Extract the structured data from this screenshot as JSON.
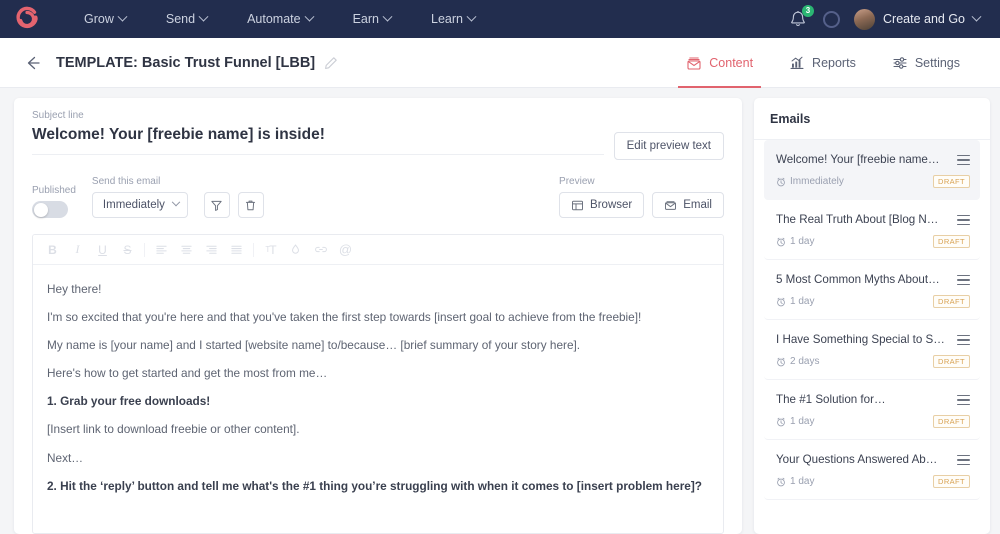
{
  "topnav": {
    "logo_icon": "spiral-logo-icon",
    "items": [
      {
        "label": "Grow"
      },
      {
        "label": "Send"
      },
      {
        "label": "Automate"
      },
      {
        "label": "Earn"
      },
      {
        "label": "Learn"
      }
    ],
    "notification_count": "3",
    "user_name": "Create and Go"
  },
  "subheader": {
    "title": "TEMPLATE: Basic Trust Funnel [LBB]",
    "tabs": [
      {
        "label": "Content",
        "icon": "envelope-icon",
        "active": true
      },
      {
        "label": "Reports",
        "icon": "bar-chart-icon",
        "active": false
      },
      {
        "label": "Settings",
        "icon": "sliders-icon",
        "active": false
      }
    ]
  },
  "editor_panel": {
    "subject_label": "Subject line",
    "subject_value": "Welcome! Your [freebie name] is inside!",
    "edit_preview_label": "Edit preview text",
    "published_label": "Published",
    "published_on": false,
    "send_label": "Send this email",
    "send_value": "Immediately",
    "preview_label": "Preview",
    "preview_browser_label": "Browser",
    "preview_email_label": "Email",
    "toolbar": [
      {
        "name": "bold-icon",
        "glyph": "B"
      },
      {
        "name": "italic-icon",
        "glyph": "I"
      },
      {
        "name": "underline-icon",
        "glyph": "U"
      },
      {
        "name": "strikethrough-icon",
        "glyph": "S"
      },
      {
        "name": "align-left-icon",
        "glyph": ""
      },
      {
        "name": "align-center-icon",
        "glyph": ""
      },
      {
        "name": "align-right-icon",
        "glyph": ""
      },
      {
        "name": "align-justify-icon",
        "glyph": ""
      },
      {
        "name": "font-size-icon",
        "glyph": "TT"
      },
      {
        "name": "text-color-icon",
        "glyph": ""
      },
      {
        "name": "link-icon",
        "glyph": ""
      },
      {
        "name": "mention-icon",
        "glyph": "@"
      }
    ],
    "body_paragraphs": [
      {
        "text": "Hey there!",
        "bold": false
      },
      {
        "text": " I'm so excited that you're here and that you've taken the first step towards [insert goal to achieve from the freebie]!",
        "bold": false
      },
      {
        "text": "My name is [your name] and I started [website name] to/because… [brief summary of your story here].",
        "bold": false
      },
      {
        "text": "Here's how to get started and get the most from me…",
        "bold": false
      },
      {
        "text": "1. Grab your free downloads!",
        "bold": true
      },
      {
        "text": "[Insert link to download freebie or other content].",
        "bold": false
      },
      {
        "text": "Next…",
        "bold": false
      },
      {
        "text": "2. Hit the ‘reply’ button and tell me what's the #1 thing you’re struggling with when it comes to [insert problem here]?",
        "bold": true
      }
    ]
  },
  "sidebar": {
    "title": "Emails",
    "emails": [
      {
        "title": "Welcome! Your [freebie name…",
        "delay": "Immediately",
        "status": "DRAFT",
        "selected": true
      },
      {
        "title": "The Real Truth About [Blog N…",
        "delay": "1 day",
        "status": "DRAFT",
        "selected": false
      },
      {
        "title": "5 Most Common Myths About…",
        "delay": "1 day",
        "status": "DRAFT",
        "selected": false
      },
      {
        "title": "I Have Something Special to S…",
        "delay": "2 days",
        "status": "DRAFT",
        "selected": false
      },
      {
        "title": "The #1 Solution for…",
        "delay": "1 day",
        "status": "DRAFT",
        "selected": false
      },
      {
        "title": "Your Questions Answered Ab…",
        "delay": "1 day",
        "status": "DRAFT",
        "selected": false
      }
    ]
  },
  "colors": {
    "nav_bg": "#222d4e",
    "accent": "#e1636e",
    "badge_green": "#2bb673",
    "draft_amber": "#d8a355",
    "page_bg": "#f4f5f7"
  }
}
